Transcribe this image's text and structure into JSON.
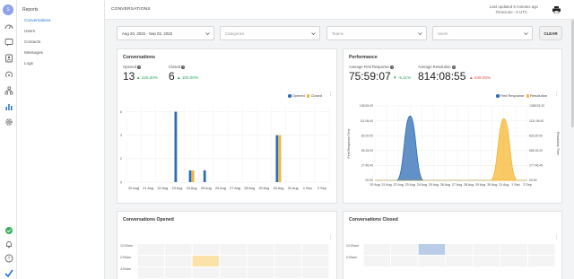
{
  "sidebar": {
    "avatar_letter": "S",
    "title": "Reports",
    "items": [
      {
        "label": "Conversations",
        "active": true
      },
      {
        "label": "Users"
      },
      {
        "label": "Contacts"
      },
      {
        "label": "Messages"
      },
      {
        "label": "Logs"
      }
    ]
  },
  "header": {
    "title": "CONVERSATIONS",
    "updated": "Last updated 5 minutes ago",
    "timezone": "Timezone : 0 UTC"
  },
  "filters": {
    "date": "Aug 20, 2022 - Sep 02, 2022",
    "categories": "Categories",
    "teams": "Teams",
    "users": "Users",
    "clear_label": "CLEAR"
  },
  "conversations_card": {
    "title": "Conversations",
    "opened_label": "Opened",
    "opened_value": "13",
    "opened_change": "225.00%",
    "closed_label": "Closed",
    "closed_value": "6",
    "closed_change": "100.00%",
    "legend_opened": "Opened",
    "legend_closed": "Closed"
  },
  "performance_card": {
    "title": "Performance",
    "afr_label": "Average First Response",
    "afr_value": "75:59:07",
    "afr_change": "-5.11%",
    "ar_label": "Average Resolution",
    "ar_value": "814:08:55",
    "ar_change": "439.36%",
    "legend_first": "First Response",
    "legend_resolution": "Resolution"
  },
  "opened_card": {
    "title": "Conversations Opened",
    "rows": [
      "12:00am",
      "2:00am",
      "4:00am"
    ]
  },
  "closed_card": {
    "title": "Conversations Closed",
    "rows": [
      "12:00am",
      "2:00am"
    ]
  },
  "colors": {
    "accent": "#1f73d0",
    "opened": "#2d6cb5",
    "closed": "#f5b731",
    "up": "#2ea45c",
    "down": "#e0514c"
  },
  "chart_data": [
    {
      "type": "bar",
      "categories": [
        "20 Aug",
        "21 Aug",
        "22 Aug",
        "23 Aug",
        "24 Aug",
        "25 Aug",
        "26 Aug",
        "27 Aug",
        "28 Aug",
        "29 Aug",
        "30 Aug",
        "31 Aug",
        "1 Sep",
        "2 Sep"
      ],
      "series": [
        {
          "name": "Opened",
          "values": [
            0,
            0,
            0,
            6,
            1,
            1,
            0,
            0,
            0,
            0,
            4,
            0,
            0,
            0
          ]
        },
        {
          "name": "Closed",
          "values": [
            0,
            0,
            0,
            0,
            1,
            0,
            0,
            0,
            0,
            0,
            4,
            0,
            0,
            0
          ]
        }
      ],
      "yticks": [
        0,
        2,
        4,
        6
      ],
      "ylim": [
        0,
        6.5
      ],
      "legend": "top-right",
      "grid": true
    },
    {
      "type": "area",
      "x": [
        "20 Aug",
        "21 Aug",
        "22 Aug",
        "23 Aug",
        "24 Aug",
        "25 Aug",
        "26 Aug",
        "27 Aug",
        "28 Aug",
        "29 Aug",
        "30 Aug",
        "31 Aug",
        "1 Sep",
        "2 Sep"
      ],
      "series": [
        {
          "name": "First Response",
          "axis": "left",
          "values": [
            0,
            0,
            0,
            120,
            0,
            0,
            0,
            0,
            0,
            0,
            0,
            0,
            0,
            0
          ]
        },
        {
          "name": "Resolution",
          "axis": "right",
          "values": [
            0,
            0,
            0,
            0,
            0,
            0,
            0,
            0,
            0,
            0,
            0,
            1150,
            0,
            0
          ]
        }
      ],
      "ylabel_left": "First Response Time",
      "ylabel_right": "Resolution Time",
      "yticks_left": [
        "00:00",
        "27:46:40",
        "55:33:20",
        "83:20:00",
        "111:06:40",
        "138:53:20"
      ],
      "yticks_right": [
        "00:00",
        "277:46:40",
        "555:33:20",
        "833:20:00",
        "1111:06:40",
        "1388:53:20"
      ],
      "legend": "top-right",
      "grid": true
    }
  ]
}
